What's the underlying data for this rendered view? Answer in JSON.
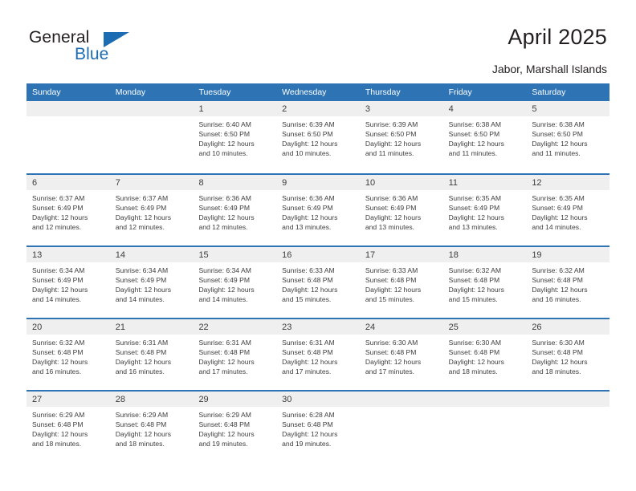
{
  "brand": {
    "word_one": "General",
    "word_two": "Blue",
    "logo_icon": "triangle-logo-icon",
    "accent_color": "#1b6cb3"
  },
  "header": {
    "title": "April 2025",
    "location": "Jabor, Marshall Islands"
  },
  "theme": {
    "header_row_bg": "#2e74b5",
    "day_band_bg": "#efefef",
    "text_color": "#3d3d3d",
    "row_divider": "#2e74b5"
  },
  "calendar": {
    "month": "April",
    "year": "2025",
    "day_names": [
      "Sunday",
      "Monday",
      "Tuesday",
      "Wednesday",
      "Thursday",
      "Friday",
      "Saturday"
    ],
    "weeks": [
      [
        {
          "day": "",
          "lines": []
        },
        {
          "day": "",
          "lines": []
        },
        {
          "day": "1",
          "lines": [
            "Sunrise: 6:40 AM",
            "Sunset: 6:50 PM",
            "Daylight: 12 hours",
            "and 10 minutes."
          ]
        },
        {
          "day": "2",
          "lines": [
            "Sunrise: 6:39 AM",
            "Sunset: 6:50 PM",
            "Daylight: 12 hours",
            "and 10 minutes."
          ]
        },
        {
          "day": "3",
          "lines": [
            "Sunrise: 6:39 AM",
            "Sunset: 6:50 PM",
            "Daylight: 12 hours",
            "and 11 minutes."
          ]
        },
        {
          "day": "4",
          "lines": [
            "Sunrise: 6:38 AM",
            "Sunset: 6:50 PM",
            "Daylight: 12 hours",
            "and 11 minutes."
          ]
        },
        {
          "day": "5",
          "lines": [
            "Sunrise: 6:38 AM",
            "Sunset: 6:50 PM",
            "Daylight: 12 hours",
            "and 11 minutes."
          ]
        }
      ],
      [
        {
          "day": "6",
          "lines": [
            "Sunrise: 6:37 AM",
            "Sunset: 6:49 PM",
            "Daylight: 12 hours",
            "and 12 minutes."
          ]
        },
        {
          "day": "7",
          "lines": [
            "Sunrise: 6:37 AM",
            "Sunset: 6:49 PM",
            "Daylight: 12 hours",
            "and 12 minutes."
          ]
        },
        {
          "day": "8",
          "lines": [
            "Sunrise: 6:36 AM",
            "Sunset: 6:49 PM",
            "Daylight: 12 hours",
            "and 12 minutes."
          ]
        },
        {
          "day": "9",
          "lines": [
            "Sunrise: 6:36 AM",
            "Sunset: 6:49 PM",
            "Daylight: 12 hours",
            "and 13 minutes."
          ]
        },
        {
          "day": "10",
          "lines": [
            "Sunrise: 6:36 AM",
            "Sunset: 6:49 PM",
            "Daylight: 12 hours",
            "and 13 minutes."
          ]
        },
        {
          "day": "11",
          "lines": [
            "Sunrise: 6:35 AM",
            "Sunset: 6:49 PM",
            "Daylight: 12 hours",
            "and 13 minutes."
          ]
        },
        {
          "day": "12",
          "lines": [
            "Sunrise: 6:35 AM",
            "Sunset: 6:49 PM",
            "Daylight: 12 hours",
            "and 14 minutes."
          ]
        }
      ],
      [
        {
          "day": "13",
          "lines": [
            "Sunrise: 6:34 AM",
            "Sunset: 6:49 PM",
            "Daylight: 12 hours",
            "and 14 minutes."
          ]
        },
        {
          "day": "14",
          "lines": [
            "Sunrise: 6:34 AM",
            "Sunset: 6:49 PM",
            "Daylight: 12 hours",
            "and 14 minutes."
          ]
        },
        {
          "day": "15",
          "lines": [
            "Sunrise: 6:34 AM",
            "Sunset: 6:49 PM",
            "Daylight: 12 hours",
            "and 14 minutes."
          ]
        },
        {
          "day": "16",
          "lines": [
            "Sunrise: 6:33 AM",
            "Sunset: 6:48 PM",
            "Daylight: 12 hours",
            "and 15 minutes."
          ]
        },
        {
          "day": "17",
          "lines": [
            "Sunrise: 6:33 AM",
            "Sunset: 6:48 PM",
            "Daylight: 12 hours",
            "and 15 minutes."
          ]
        },
        {
          "day": "18",
          "lines": [
            "Sunrise: 6:32 AM",
            "Sunset: 6:48 PM",
            "Daylight: 12 hours",
            "and 15 minutes."
          ]
        },
        {
          "day": "19",
          "lines": [
            "Sunrise: 6:32 AM",
            "Sunset: 6:48 PM",
            "Daylight: 12 hours",
            "and 16 minutes."
          ]
        }
      ],
      [
        {
          "day": "20",
          "lines": [
            "Sunrise: 6:32 AM",
            "Sunset: 6:48 PM",
            "Daylight: 12 hours",
            "and 16 minutes."
          ]
        },
        {
          "day": "21",
          "lines": [
            "Sunrise: 6:31 AM",
            "Sunset: 6:48 PM",
            "Daylight: 12 hours",
            "and 16 minutes."
          ]
        },
        {
          "day": "22",
          "lines": [
            "Sunrise: 6:31 AM",
            "Sunset: 6:48 PM",
            "Daylight: 12 hours",
            "and 17 minutes."
          ]
        },
        {
          "day": "23",
          "lines": [
            "Sunrise: 6:31 AM",
            "Sunset: 6:48 PM",
            "Daylight: 12 hours",
            "and 17 minutes."
          ]
        },
        {
          "day": "24",
          "lines": [
            "Sunrise: 6:30 AM",
            "Sunset: 6:48 PM",
            "Daylight: 12 hours",
            "and 17 minutes."
          ]
        },
        {
          "day": "25",
          "lines": [
            "Sunrise: 6:30 AM",
            "Sunset: 6:48 PM",
            "Daylight: 12 hours",
            "and 18 minutes."
          ]
        },
        {
          "day": "26",
          "lines": [
            "Sunrise: 6:30 AM",
            "Sunset: 6:48 PM",
            "Daylight: 12 hours",
            "and 18 minutes."
          ]
        }
      ],
      [
        {
          "day": "27",
          "lines": [
            "Sunrise: 6:29 AM",
            "Sunset: 6:48 PM",
            "Daylight: 12 hours",
            "and 18 minutes."
          ]
        },
        {
          "day": "28",
          "lines": [
            "Sunrise: 6:29 AM",
            "Sunset: 6:48 PM",
            "Daylight: 12 hours",
            "and 18 minutes."
          ]
        },
        {
          "day": "29",
          "lines": [
            "Sunrise: 6:29 AM",
            "Sunset: 6:48 PM",
            "Daylight: 12 hours",
            "and 19 minutes."
          ]
        },
        {
          "day": "30",
          "lines": [
            "Sunrise: 6:28 AM",
            "Sunset: 6:48 PM",
            "Daylight: 12 hours",
            "and 19 minutes."
          ]
        },
        {
          "day": "",
          "lines": []
        },
        {
          "day": "",
          "lines": []
        },
        {
          "day": "",
          "lines": []
        }
      ]
    ]
  }
}
